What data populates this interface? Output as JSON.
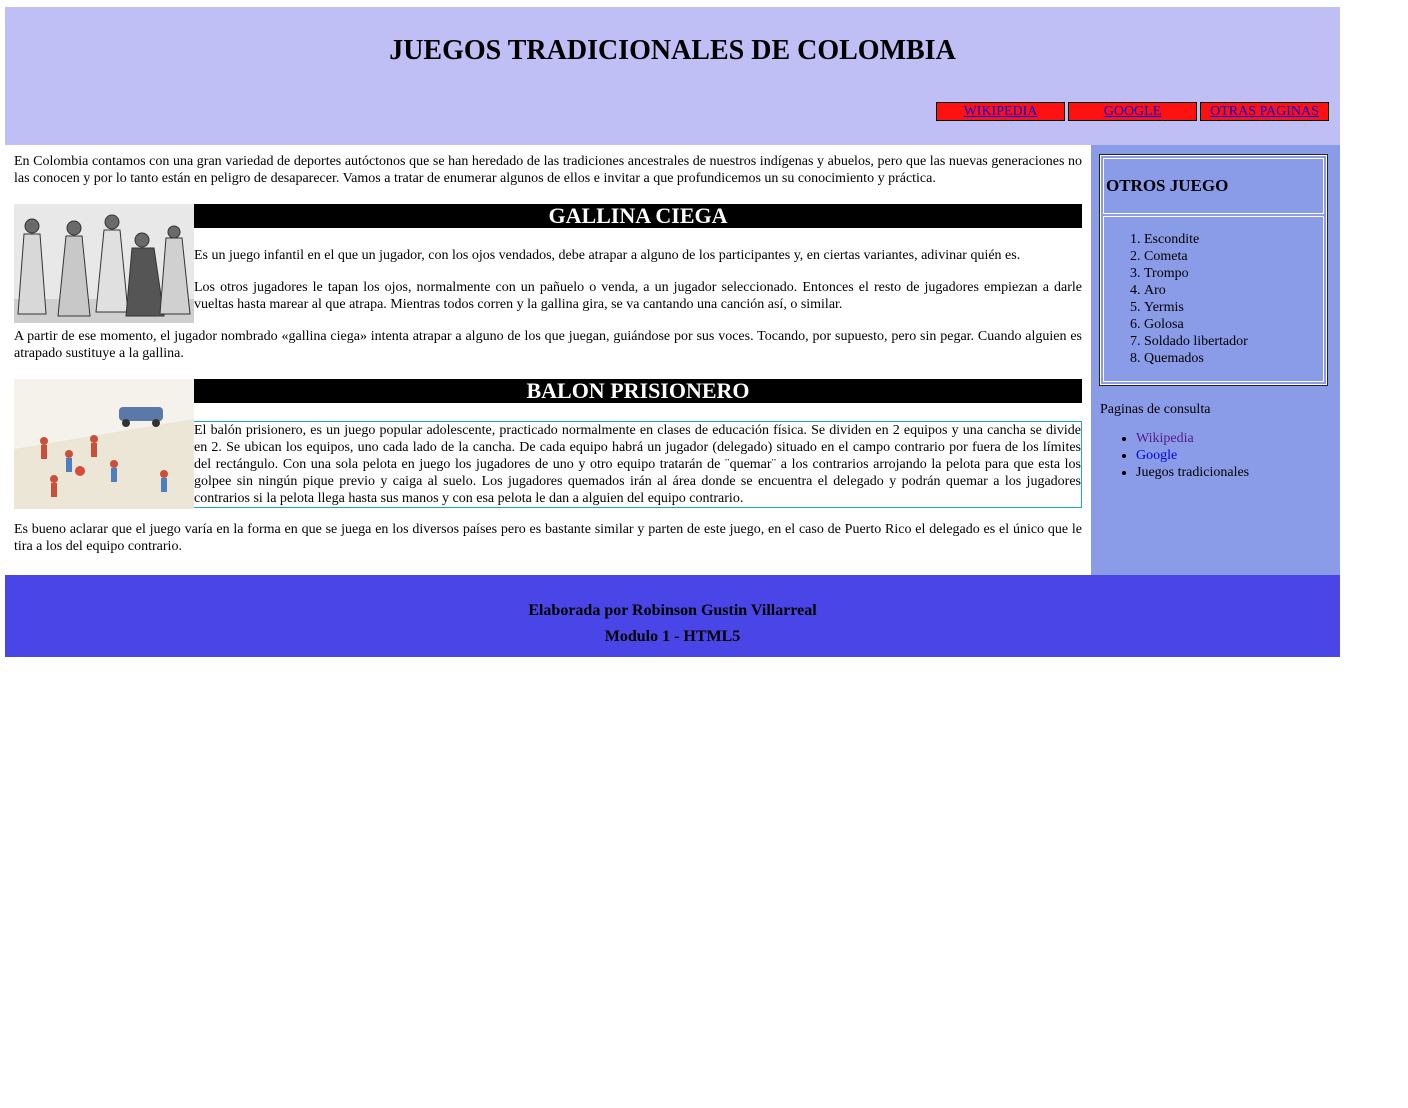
{
  "header": {
    "title": "JUEGOS TRADICIONALES DE COLOMBIA",
    "nav": [
      "WIKIPEDIA",
      "GOOGLE",
      "OTRAS PAGINAS"
    ]
  },
  "main": {
    "intro": "En Colombia contamos con una gran variedad de deportes autóctonos que se han heredado de las tradiciones ancestrales de nuestros indígenas y abuelos, pero que las nuevas generaciones no las conocen y por lo tanto están en peligro de desaparecer. Vamos a tratar de enumerar algunos de ellos e invitar a que profundicemos un su conocimiento y práctica.",
    "section1": {
      "title": "GALLINA CIEGA",
      "p1": "Es un juego infantil en el que un jugador, con los ojos vendados, debe atrapar a alguno de los participantes y, en ciertas variantes, adivinar quién es.",
      "p2": "Los otros jugadores le tapan los ojos, normalmente con un pañuelo o venda, a un jugador seleccionado. Entonces el resto de jugadores empiezan a darle vueltas hasta marear al que atrapa. Mientras todos corren y la gallina gira, se va cantando una canción así, o similar.",
      "p3": "A partir de ese momento, el jugador nombrado «gallina ciega» intenta atrapar a alguno de los que juegan, guiándose por sus voces. Tocando, por supuesto, pero sin pegar. Cuando alguien es atrapado sustituye a la gallina."
    },
    "section2": {
      "title": "BALON PRISIONERO",
      "p1": "El balón prisionero, es un juego popular adolescente, practicado normalmente en clases de educación física. Se dividen en 2 equipos y una cancha se divide en 2. Se ubican los equipos, uno cada lado de la cancha. De cada equipo habrá un jugador (delegado) situado en el campo contrario por fuera de los límites del rectángulo. Con una sola pelota en juego los jugadores de uno y otro equipo tratarán de ¨quemar¨ a los contrarios arrojando la pelota para que esta los golpee sin ningún pique previo y caiga al suelo. Los jugadores quemados irán al área donde se encuentra el delegado y podrán quemar a los jugadores contrarios si la pelota llega hasta sus manos y con esa pelota le dan a alguien del equipo contrario.",
      "p2": "Es bueno aclarar que el juego varía en la forma en que se juega en los diversos países pero es bastante similar y parten de este juego, en el caso de Puerto Rico el delegado es el único que le tira a los del equipo contrario."
    }
  },
  "aside": {
    "table_title": "OTROS JUEGO",
    "games": [
      "Escondite",
      "Cometa",
      "Trompo",
      "Aro",
      "Yermis",
      "Golosa",
      "Soldado libertador",
      "Quemados"
    ],
    "links_title": "Paginas de consulta",
    "links": [
      "Wikipedia",
      "Google",
      "Juegos tradicionales"
    ]
  },
  "footer": {
    "line1": "Elaborada por Robinson Gustin Villarreal",
    "line2": "Modulo 1 - HTML5"
  }
}
